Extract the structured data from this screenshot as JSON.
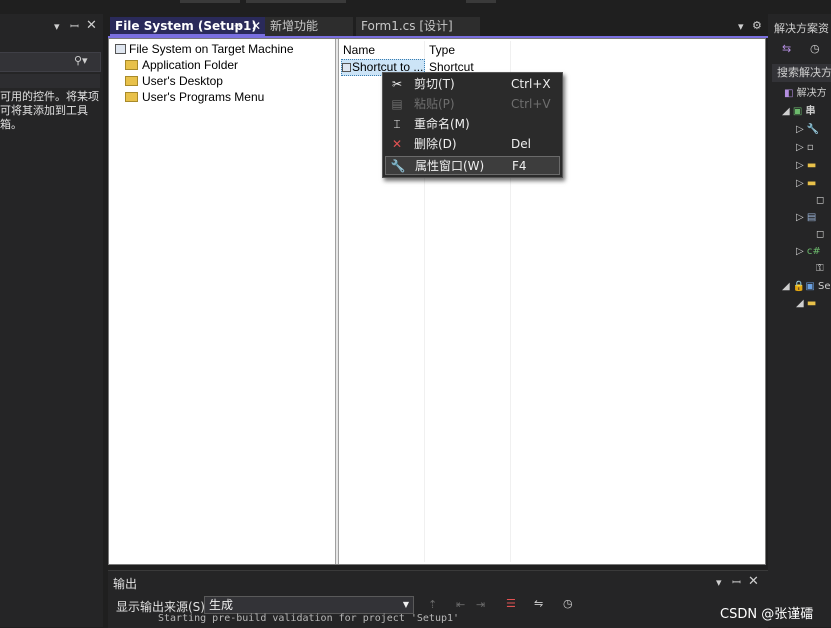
{
  "toolbox": {
    "hint_lines": "可用的控件。将某项\n可将其添加到工具\n箱。"
  },
  "tabs": [
    {
      "label": "File System (Setup1)"
    },
    {
      "label": "新增功能"
    },
    {
      "label": "Form1.cs [设计]"
    }
  ],
  "tree": {
    "root": "File System on Target Machine",
    "children": [
      "Application Folder",
      "User's Desktop",
      "User's Programs Menu"
    ]
  },
  "list": {
    "columns": [
      "Name",
      "Type"
    ],
    "rows": [
      {
        "name": "Shortcut to ...",
        "type": "Shortcut"
      }
    ]
  },
  "context_menu": {
    "items": [
      {
        "icon": "scissors-icon",
        "label": "剪切(T)",
        "shortcut": "Ctrl+X",
        "enabled": true
      },
      {
        "icon": "paste-icon",
        "label": "粘贴(P)",
        "shortcut": "Ctrl+V",
        "enabled": false
      },
      {
        "icon": "rename-icon",
        "label": "重命名(M)",
        "shortcut": "",
        "enabled": true
      },
      {
        "icon": "delete-icon",
        "label": "删除(D)",
        "shortcut": "Del",
        "enabled": true
      },
      {
        "icon": "wrench-icon",
        "label": "属性窗口(W)",
        "shortcut": "F4",
        "enabled": true
      }
    ]
  },
  "solution_explorer": {
    "title": "解决方案资",
    "search_placeholder": "搜索解决方",
    "root_label": "解决方",
    "project_label": "串",
    "setup_label": "Se"
  },
  "output": {
    "title": "输出",
    "source_label": "显示输出来源(S):",
    "source_value": "生成",
    "log_line": "Starting pre-build validation for project 'Setup1'"
  },
  "watermark": "CSDN @张谨礌"
}
